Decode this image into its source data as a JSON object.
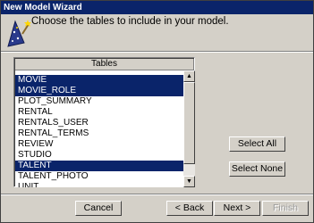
{
  "window": {
    "title": "New Model Wizard"
  },
  "header": {
    "instruction": "Choose the tables to include in your model."
  },
  "table": {
    "column_header": "Tables",
    "rows": [
      {
        "label": "MOVIE",
        "selected": true
      },
      {
        "label": "MOVIE_ROLE",
        "selected": true
      },
      {
        "label": "PLOT_SUMMARY",
        "selected": false
      },
      {
        "label": "RENTAL",
        "selected": false
      },
      {
        "label": "RENTALS_USER",
        "selected": false
      },
      {
        "label": "RENTAL_TERMS",
        "selected": false
      },
      {
        "label": "REVIEW",
        "selected": false
      },
      {
        "label": "STUDIO",
        "selected": false
      },
      {
        "label": "TALENT",
        "selected": true
      },
      {
        "label": "TALENT_PHOTO",
        "selected": false
      },
      {
        "label": "UNIT",
        "selected": false
      }
    ]
  },
  "buttons": {
    "select_all": "Select All",
    "select_none": "Select None",
    "cancel": "Cancel",
    "back": "< Back",
    "next": "Next >",
    "finish": "Finish"
  },
  "colors": {
    "selection": "#0a246a",
    "titlebar": "#0a246a",
    "face": "#d4d0c8"
  }
}
